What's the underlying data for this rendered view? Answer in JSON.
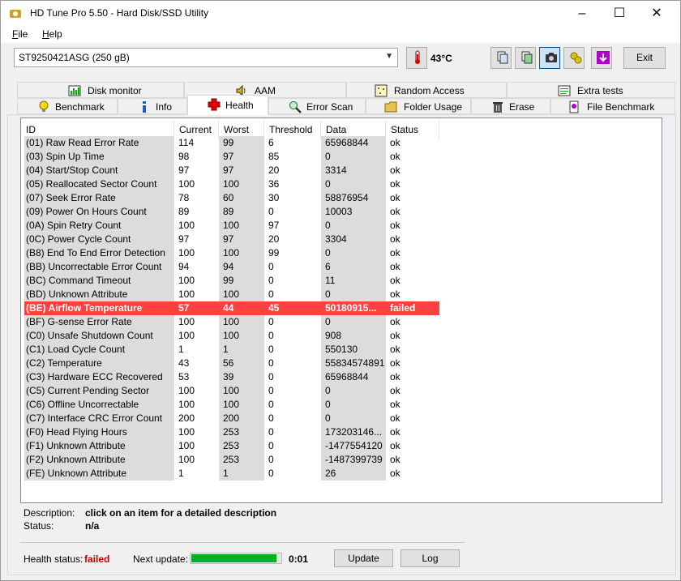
{
  "window": {
    "title": "HD Tune Pro 5.50 - Hard Disk/SSD Utility",
    "minimize": "–",
    "maximize": "☐",
    "close": "✕"
  },
  "menu": {
    "file": "File",
    "file_mn": "F",
    "file_rest": "ile",
    "help_mn": "H",
    "help_rest": "elp"
  },
  "toolbar": {
    "drive": "ST9250421ASG (250 gB)",
    "temperature": "43°C",
    "exit": "Exit"
  },
  "tabs_top": [
    "Disk monitor",
    "AAM",
    "Random Access",
    "Extra tests"
  ],
  "tabs_bottom": [
    "Benchmark",
    "Info",
    "Health",
    "Error Scan",
    "Folder Usage",
    "Erase",
    "File Benchmark"
  ],
  "table": {
    "headers": [
      "ID",
      "Current",
      "Worst",
      "Threshold",
      "Data",
      "Status"
    ],
    "rows": [
      [
        "(01) Raw Read Error Rate",
        "114",
        "99",
        "6",
        "65968844",
        "ok"
      ],
      [
        "(03) Spin Up Time",
        "98",
        "97",
        "85",
        "0",
        "ok"
      ],
      [
        "(04) Start/Stop Count",
        "97",
        "97",
        "20",
        "3314",
        "ok"
      ],
      [
        "(05) Reallocated Sector Count",
        "100",
        "100",
        "36",
        "0",
        "ok"
      ],
      [
        "(07) Seek Error Rate",
        "78",
        "60",
        "30",
        "58876954",
        "ok"
      ],
      [
        "(09) Power On Hours Count",
        "89",
        "89",
        "0",
        "10003",
        "ok"
      ],
      [
        "(0A) Spin Retry Count",
        "100",
        "100",
        "97",
        "0",
        "ok"
      ],
      [
        "(0C) Power Cycle Count",
        "97",
        "97",
        "20",
        "3304",
        "ok"
      ],
      [
        "(B8) End To End Error Detection",
        "100",
        "100",
        "99",
        "0",
        "ok"
      ],
      [
        "(BB) Uncorrectable Error Count",
        "94",
        "94",
        "0",
        "6",
        "ok"
      ],
      [
        "(BC) Command Timeout",
        "100",
        "99",
        "0",
        "11",
        "ok"
      ],
      [
        "(BD) Unknown Attribute",
        "100",
        "100",
        "0",
        "0",
        "ok"
      ],
      [
        "(BE) Airflow Temperature",
        "57",
        "44",
        "45",
        "50180915...",
        "failed"
      ],
      [
        "(BF) G-sense Error Rate",
        "100",
        "100",
        "0",
        "0",
        "ok"
      ],
      [
        "(C0) Unsafe Shutdown Count",
        "100",
        "100",
        "0",
        "908",
        "ok"
      ],
      [
        "(C1) Load Cycle Count",
        "1",
        "1",
        "0",
        "550130",
        "ok"
      ],
      [
        "(C2) Temperature",
        "43",
        "56",
        "0",
        "55834574891",
        "ok"
      ],
      [
        "(C3) Hardware ECC Recovered",
        "53",
        "39",
        "0",
        "65968844",
        "ok"
      ],
      [
        "(C5) Current Pending Sector",
        "100",
        "100",
        "0",
        "0",
        "ok"
      ],
      [
        "(C6) Offline Uncorrectable",
        "100",
        "100",
        "0",
        "0",
        "ok"
      ],
      [
        "(C7) Interface CRC Error Count",
        "200",
        "200",
        "0",
        "0",
        "ok"
      ],
      [
        "(F0) Head Flying Hours",
        "100",
        "253",
        "0",
        "173203146...",
        "ok"
      ],
      [
        "(F1) Unknown Attribute",
        "100",
        "253",
        "0",
        "-1477554120",
        "ok"
      ],
      [
        "(F2) Unknown Attribute",
        "100",
        "253",
        "0",
        "-1487399739",
        "ok"
      ],
      [
        "(FE) Unknown Attribute",
        "1",
        "1",
        "0",
        "26",
        "ok"
      ]
    ]
  },
  "description": {
    "label": "Description:",
    "value": "click on an item for a detailed description"
  },
  "status": {
    "label": "Status:",
    "value": "n/a"
  },
  "footer": {
    "health_label": "Health status:",
    "health_value": "failed",
    "next_update_label": "Next update:",
    "progress_fraction": 0.95,
    "timer": "0:01",
    "update_button": "Update",
    "log_button": "Log"
  },
  "colors": {
    "failed_row": "#ff4040",
    "failed_text": "#c00000",
    "progress": "#06b025"
  }
}
